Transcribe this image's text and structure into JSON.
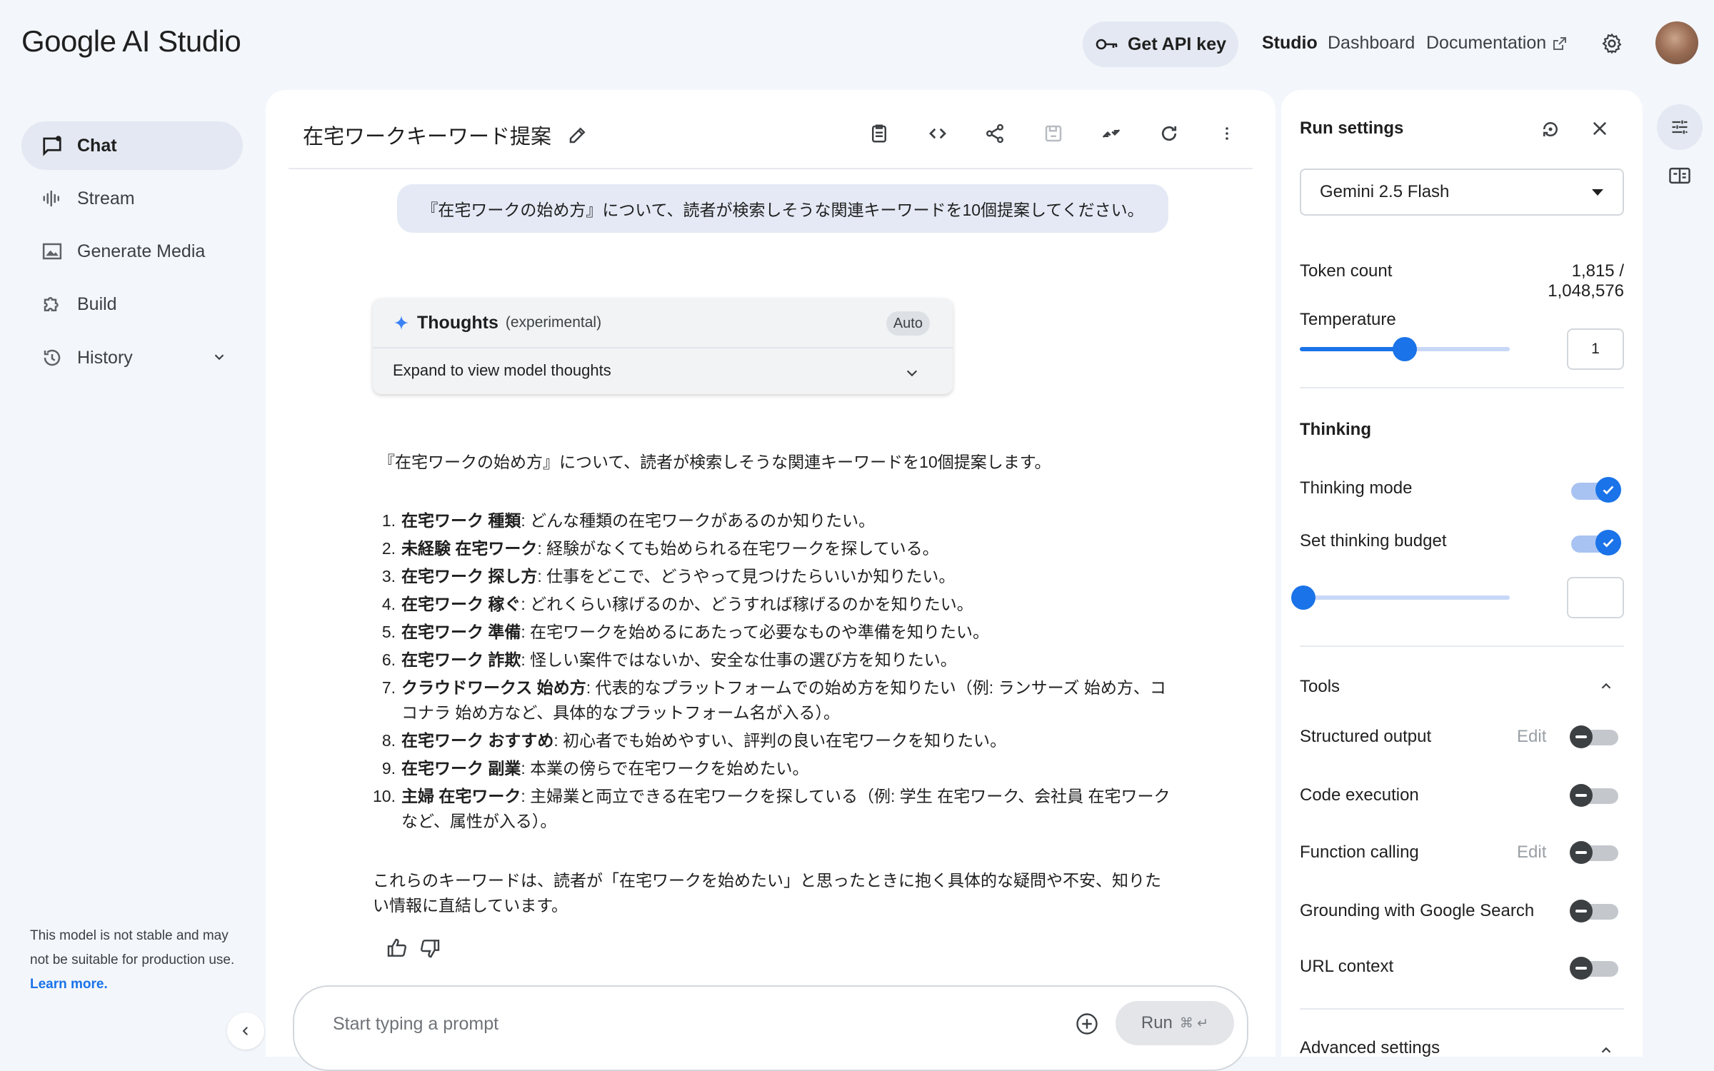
{
  "app": {
    "logo_google": "Google",
    "logo_product": "AI Studio"
  },
  "topbar": {
    "api_key_label": "Get API key",
    "nav": [
      {
        "label": "Studio"
      },
      {
        "label": "Dashboard"
      },
      {
        "label": "Documentation"
      }
    ]
  },
  "sidebar": {
    "items": [
      {
        "label": "Chat",
        "icon": "chat-icon",
        "active": true
      },
      {
        "label": "Stream",
        "icon": "waveform-icon"
      },
      {
        "label": "Generate Media",
        "icon": "image-icon"
      },
      {
        "label": "Build",
        "icon": "puzzle-icon"
      },
      {
        "label": "History",
        "icon": "history-icon"
      }
    ],
    "notice_text": "This model is not stable and may not be suitable for production use.",
    "notice_link": "Learn more."
  },
  "chat": {
    "title": "在宅ワークキーワード提案",
    "user_message": "『在宅ワークの始め方』について、読者が検索しそうな関連キーワードを10個提案してください。",
    "thoughts": {
      "title": "Thoughts",
      "subtitle": "(experimental)",
      "badge": "Auto",
      "expand_label": "Expand to view model thoughts"
    },
    "response": {
      "intro": "『在宅ワークの始め方』について、読者が検索しそうな関連キーワードを10個提案します。",
      "items": [
        {
          "num": "1.",
          "keyword": "在宅ワーク 種類",
          "text": ": どんな種類の在宅ワークがあるのか知りたい。"
        },
        {
          "num": "2.",
          "keyword": "未経験 在宅ワーク",
          "text": ": 経験がなくても始められる在宅ワークを探している。"
        },
        {
          "num": "3.",
          "keyword": "在宅ワーク 探し方",
          "text": ": 仕事をどこで、どうやって見つけたらいいか知りたい。"
        },
        {
          "num": "4.",
          "keyword": "在宅ワーク 稼ぐ",
          "text": ": どれくらい稼げるのか、どうすれば稼げるのかを知りたい。"
        },
        {
          "num": "5.",
          "keyword": "在宅ワーク 準備",
          "text": ": 在宅ワークを始めるにあたって必要なものや準備を知りたい。"
        },
        {
          "num": "6.",
          "keyword": "在宅ワーク 詐欺",
          "text": ": 怪しい案件ではないか、安全な仕事の選び方を知りたい。"
        },
        {
          "num": "7.",
          "keyword": "クラウドワークス 始め方",
          "text": ": 代表的なプラットフォームでの始め方を知りたい（例: ランサーズ 始め方、ココナラ 始め方など、具体的なプラットフォーム名が入る）。"
        },
        {
          "num": "8.",
          "keyword": "在宅ワーク おすすめ",
          "text": ": 初心者でも始めやすい、評判の良い在宅ワークを知りたい。"
        },
        {
          "num": "9.",
          "keyword": "在宅ワーク 副業",
          "text": ": 本業の傍らで在宅ワークを始めたい。"
        },
        {
          "num": "10.",
          "keyword": "主婦 在宅ワーク",
          "text": ": 主婦業と両立できる在宅ワークを探している（例: 学生 在宅ワーク、会社員 在宅ワーク など、属性が入る）。"
        }
      ],
      "outro": "これらのキーワードは、読者が「在宅ワークを始めたい」と思ったときに抱く具体的な疑問や不安、知りたい情報に直結しています。"
    },
    "prompt_placeholder": "Start typing a prompt",
    "run_label": "Run",
    "run_shortcut": "⌘ ↵"
  },
  "run_settings": {
    "title": "Run settings",
    "model": "Gemini 2.5 Flash",
    "token_count_label": "Token count",
    "token_count_value": "1,815 / 1,048,576",
    "temperature_label": "Temperature",
    "temperature_value": "1",
    "temperature_level": 0.5,
    "thinking_header": "Thinking",
    "thinking_mode_label": "Thinking mode",
    "thinking_mode_on": true,
    "thinking_budget_label": "Set thinking budget",
    "thinking_budget_on": true,
    "thinking_budget_level": 0,
    "tools_header": "Tools",
    "tools": [
      {
        "label": "Structured output",
        "edit": "Edit",
        "on": false
      },
      {
        "label": "Code execution",
        "on": false
      },
      {
        "label": "Function calling",
        "edit": "Edit",
        "on": false
      },
      {
        "label": "Grounding with Google Search",
        "on": false
      },
      {
        "label": "URL context",
        "on": false
      }
    ],
    "advanced_header": "Advanced settings"
  },
  "colors": {
    "accent": "#1a73e8",
    "page_bg": "#f3f6fb",
    "active_nav_bg": "#e3e8f2",
    "user_bubble": "#e4e9f5"
  }
}
